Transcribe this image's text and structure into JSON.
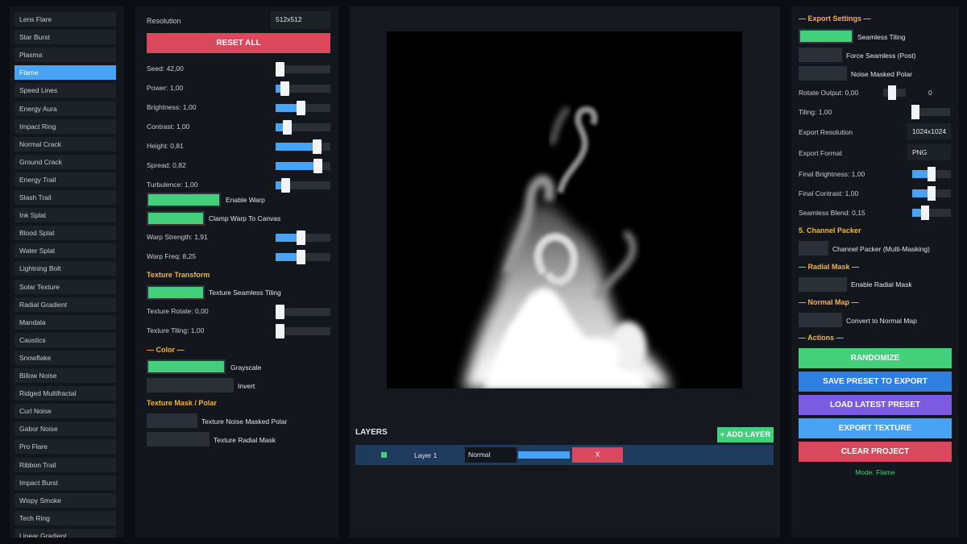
{
  "presets": {
    "items": [
      "Lens Flare",
      "Star Burst",
      "Plasma",
      "Flame",
      "Speed Lines",
      "Energy Aura",
      "Impact Ring",
      "Normal Crack",
      "Ground Crack",
      "Energy Trail",
      "Slash Trail",
      "Ink Splat",
      "Blood Splat",
      "Water Splat",
      "Lightning Bolt",
      "Solar Texture",
      "Radial Gradient",
      "Mandala",
      "Caustics",
      "Snowflake",
      "Billow Noise",
      "Ridged Multifractal",
      "Curl Noise",
      "Gabor Noise",
      "Pro Flare",
      "Ribbon Trail",
      "Impact Burst",
      "Wispy Smoke",
      "Tech Ring",
      "Linear Gradient"
    ],
    "active_index": 3
  },
  "params": {
    "resolution_label": "Resolution",
    "resolution_value": "512x512",
    "reset_label": "RESET ALL",
    "sliders": [
      {
        "label": "Seed: 42,00",
        "fraction": 0.0
      },
      {
        "label": "Power: 1,00",
        "fraction": 0.1
      },
      {
        "label": "Brightness: 1,00",
        "fraction": 0.45
      },
      {
        "label": "Contrast: 1,00",
        "fraction": 0.15
      },
      {
        "label": "Height: 0,81",
        "fraction": 0.81
      },
      {
        "label": "Spread: 0,82",
        "fraction": 0.82
      },
      {
        "label": "Turbulence: 1,00",
        "fraction": 0.13
      }
    ],
    "enable_warp": "Enable Warp",
    "clamp_warp": "Clamp Warp To Canvas",
    "warp_sliders": [
      {
        "label": "Warp Strength: 1,91",
        "fraction": 0.45
      },
      {
        "label": "Warp Freq: 8,25",
        "fraction": 0.45
      }
    ],
    "texture_transform_title": "Texture Transform",
    "texture_seamless": "Texture Seamless Tiling",
    "transform_sliders": [
      {
        "label": "Texture Rotate: 0,00",
        "fraction": 0.0
      },
      {
        "label": "Texture Tiling: 1,00",
        "fraction": 0.0
      }
    ],
    "color_title": "— Color —",
    "grayscale": "Grayscale",
    "invert": "Invert",
    "mask_title": "Texture Mask / Polar",
    "noise_masked_polar": "Texture Noise Masked Polar",
    "radial_mask": "Texture Radial Mask"
  },
  "layers": {
    "title": "LAYERS",
    "add_label": "+ ADD LAYER",
    "items": [
      {
        "name": "Layer 1",
        "blend": "Normal",
        "delete_label": "X",
        "opacity": 1.0
      }
    ]
  },
  "export": {
    "title": "— Export Settings —",
    "seamless_tiling": "Seamless Tiling",
    "force_seamless": "Force Seamless (Post)",
    "noise_masked_polar": "Noise Masked Polar",
    "rotate_output_label": "Rotate Output: 0,00",
    "rotate_output_value": "0",
    "rotate_fraction": 0.35,
    "tiling_label": "Tiling: 1,00",
    "tiling_fraction": 0.0,
    "export_resolution_label": "Export Resolution",
    "export_resolution_value": "1024x1024",
    "export_format_label": "Export Format",
    "export_format_value": "PNG",
    "final_brightness_label": "Final Brightness: 1,00",
    "final_brightness_fraction": 0.5,
    "final_contrast_label": "Final Contrast: 1,00",
    "final_contrast_fraction": 0.5,
    "seamless_blend_label": "Seamless Blend: 0,15",
    "seamless_blend_fraction": 0.28,
    "channel_packer_title": "5. Channel Packer",
    "channel_packer": "Channel Packer (Multi-Masking)",
    "radial_mask_title": "— Radial Mask —",
    "enable_radial_mask": "Enable Radial Mask",
    "normal_map_title": "— Normal Map —",
    "convert_normal_map": "Convert to Normal Map",
    "actions_title": "— Actions —",
    "randomize": "RANDOMIZE",
    "save_preset": "SAVE PRESET TO EXPORT",
    "load_preset": "LOAD LATEST PRESET",
    "export_texture": "EXPORT TEXTURE",
    "clear_project": "CLEAR PROJECT",
    "mode": "Mode: Flame"
  },
  "colors": {
    "accent_blue": "#4aa2f4",
    "green": "#44cf7a",
    "red": "#d9485c",
    "purple": "#7b5be0",
    "section_gold": "#f2b440"
  }
}
